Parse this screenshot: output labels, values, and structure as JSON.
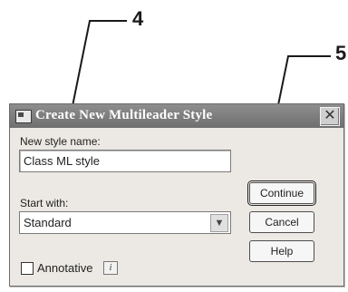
{
  "callouts": [
    "4",
    "5"
  ],
  "dialog": {
    "title": "Create New Multileader Style",
    "close_glyph": "✕",
    "new_style_label": "New style name:",
    "new_style_value": "Class ML style",
    "start_with_label": "Start with:",
    "start_with_value": "Standard",
    "dropdown_glyph": "▼",
    "annotative_label": "Annotative",
    "info_glyph": "i",
    "buttons": {
      "continue": "Continue",
      "cancel": "Cancel",
      "help": "Help"
    }
  }
}
